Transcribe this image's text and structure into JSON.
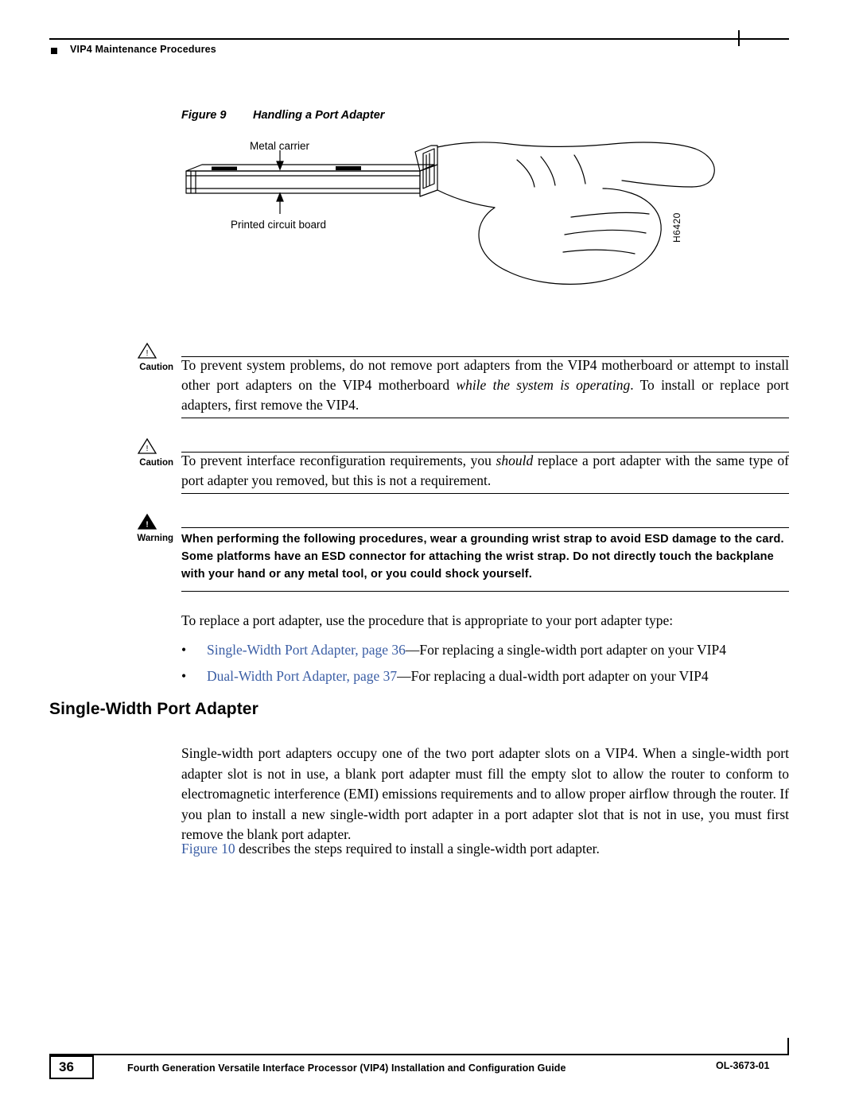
{
  "header": {
    "running_head": "VIP4 Maintenance Procedures",
    "bullet_icon": "square-bullet-icon"
  },
  "figure": {
    "label": "Figure 9",
    "title": "Handling a Port Adapter",
    "callouts": {
      "metal_carrier": "Metal carrier",
      "printed_circuit_board": "Printed circuit board"
    },
    "art_id": "H6420",
    "alt": "Illustration of a hand holding a port adapter by the metal carrier"
  },
  "admonitions": [
    {
      "label": "Caution",
      "icon": "caution-triangle-icon",
      "text_parts": [
        {
          "text": "To prevent system problems, do not remove port adapters from the VIP4 motherboard or attempt to install other port adapters on the VIP4 motherboard ",
          "style": "normal"
        },
        {
          "text": "while the system is operating",
          "style": "italic"
        },
        {
          "text": ". To install or replace port adapters, first remove the VIP4.",
          "style": "normal"
        }
      ]
    },
    {
      "label": "Caution",
      "icon": "caution-triangle-icon",
      "text_parts": [
        {
          "text": "To prevent interface reconfiguration requirements, you ",
          "style": "normal"
        },
        {
          "text": "should",
          "style": "italic"
        },
        {
          "text": " replace a port adapter with the same type of port adapter you removed, but this is not a requirement.",
          "style": "normal"
        }
      ]
    },
    {
      "label": "Warning",
      "icon": "warning-triangle-icon",
      "text_parts": [
        {
          "text": "When performing the following procedures, wear a grounding wrist strap to avoid ESD damage to the card. Some platforms have an ESD connector for attaching the wrist strap. Do not directly touch the backplane with your hand or any metal tool, or you could shock yourself.",
          "style": "bold"
        }
      ]
    }
  ],
  "body": {
    "intro_paragraph": "To replace a port adapter, use the procedure that is appropriate to your port adapter type:",
    "bullets": [
      {
        "link": "Single-Width Port Adapter, page 36",
        "rest": "—For replacing a single-width port adapter on your VIP4"
      },
      {
        "link": "Dual-Width Port Adapter, page 37",
        "rest": "—For replacing a dual-width port adapter on your VIP4"
      }
    ],
    "section_title": "Single-Width Port Adapter",
    "section_paragraph": "Single-width port adapters occupy one of the two port adapter slots on a VIP4. When a single-width port adapter slot is not in use, a blank port adapter must fill the empty slot to allow the router to conform to electromagnetic interference (EMI) emissions requirements and to allow proper airflow through the router. If you plan to install a new single-width port adapter in a port adapter slot that is not in use, you must first remove the blank port adapter.",
    "figure_ref_link": "Figure 10",
    "figure_ref_rest": " describes the steps required to install a single-width port adapter."
  },
  "footer": {
    "page_number": "36",
    "guide_title": "Fourth Generation Versatile Interface Processor (VIP4) Installation and Configuration Guide",
    "doc_number": "OL-3673-01"
  },
  "colors": {
    "link": "#3B5EA5",
    "text": "#000000",
    "rule": "#000000"
  }
}
